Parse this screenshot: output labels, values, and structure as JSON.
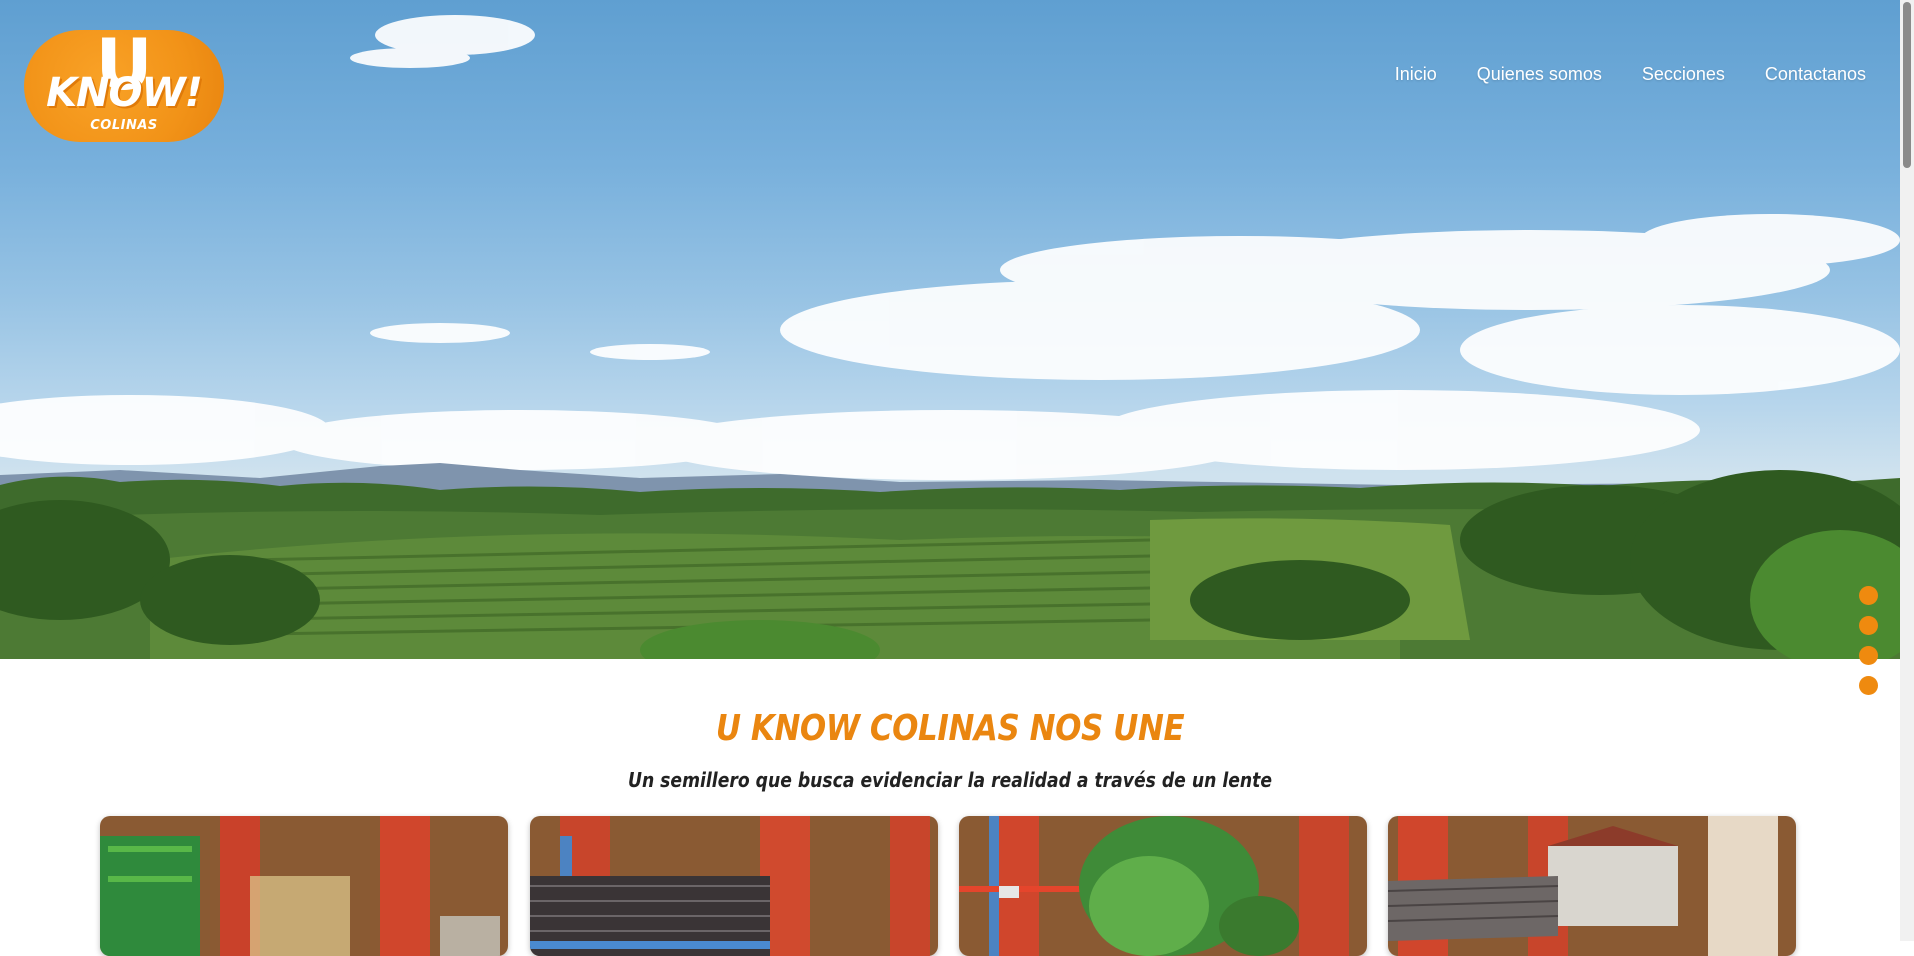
{
  "brand": {
    "logo_letter": "U",
    "logo_wordmark": "KNOW!",
    "logo_sub": "COLINAS",
    "accent_color": "#ea8610"
  },
  "nav": {
    "items": [
      {
        "label": "Inicio"
      },
      {
        "label": "Quienes somos"
      },
      {
        "label": "Secciones"
      },
      {
        "label": "Contactanos"
      }
    ]
  },
  "hero": {
    "image": "coffee-farm-landscape",
    "slider_dots": 4
  },
  "intro": {
    "title": "U KNOW COLINAS NOS UNE",
    "subtitle": "Un semillero que busca evidenciar la realidad a través de un lente"
  },
  "gallery": {
    "cards": [
      {
        "image": "museum-interior-1"
      },
      {
        "image": "museum-interior-2"
      },
      {
        "image": "museum-interior-3"
      },
      {
        "image": "museum-interior-4"
      }
    ]
  }
}
